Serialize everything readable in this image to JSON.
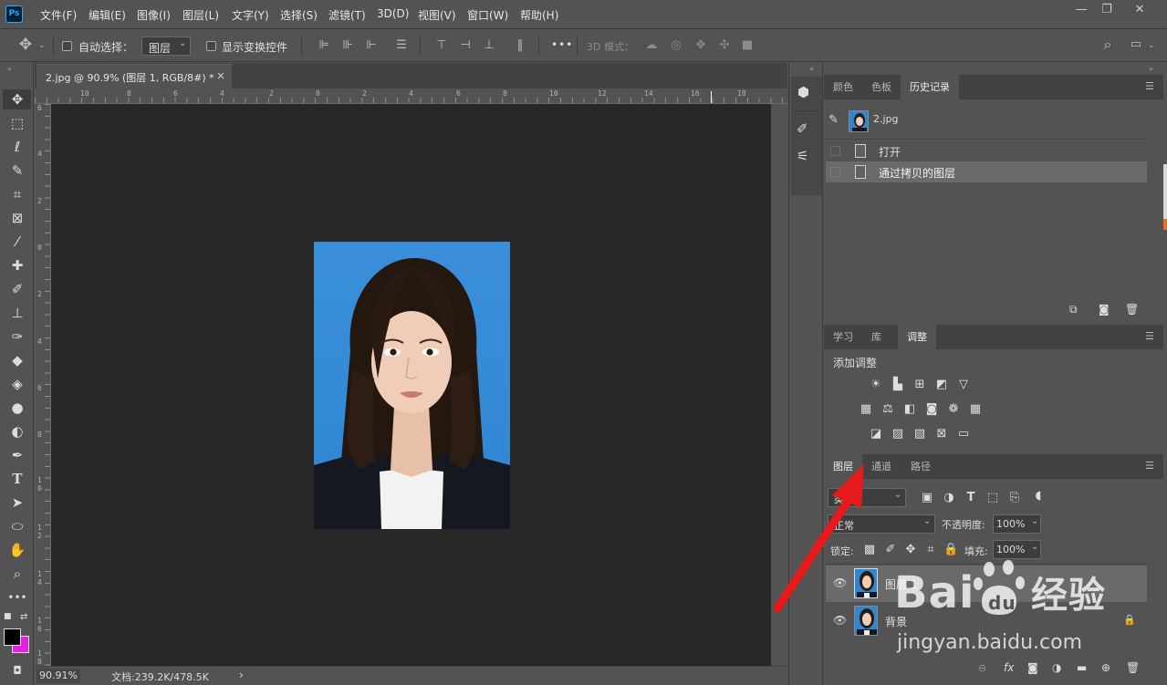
{
  "menubar": {
    "logo": "Ps",
    "items": [
      "文件(F)",
      "编辑(E)",
      "图像(I)",
      "图层(L)",
      "文字(Y)",
      "选择(S)",
      "滤镜(T)",
      "3D(D)",
      "视图(V)",
      "窗口(W)",
      "帮助(H)"
    ],
    "window_controls": [
      "—",
      "❐",
      "✕"
    ]
  },
  "options": {
    "auto_select_label": "自动选择：",
    "auto_select_value": "图层",
    "show_transform_label": "显示变换控件",
    "more": "•••",
    "mode_3d_label": "3D 模式："
  },
  "document": {
    "tab_title": "2.jpg @ 90.9% (图层 1, RGB/8#) *",
    "tab_close": "×",
    "ruler_top": [
      "10",
      "8",
      "6",
      "4",
      "2",
      "0",
      "2",
      "4",
      "6",
      "8",
      "10",
      "12",
      "14",
      "16",
      "18"
    ],
    "ruler_left": [
      "6",
      "4",
      "2",
      "0",
      "2",
      "4",
      "6",
      "8",
      "1\n0",
      "1\n2",
      "1\n4",
      "1\n6",
      "1\n8"
    ],
    "zoom": "90.91%",
    "doc_info": "文档:239.2K/478.5K",
    "status_arrow": "›"
  },
  "history_panel": {
    "tabs": [
      "颜色",
      "色板",
      "历史记录"
    ],
    "active_tab": "历史记录",
    "snapshot": "2.jpg",
    "steps": [
      "打开",
      "通过拷贝的图层"
    ]
  },
  "adjust_panel": {
    "tabs": [
      "学习",
      "库",
      "调整"
    ],
    "active_tab": "调整",
    "title": "添加调整"
  },
  "layers_panel": {
    "tabs": [
      "图层",
      "通道",
      "路径"
    ],
    "active_tab": "图层",
    "filter_label": "类型",
    "blend_mode": "正常",
    "opacity_label": "不透明度:",
    "opacity_value": "100%",
    "lock_label": "锁定:",
    "fill_label": "填充:",
    "fill_value": "100%",
    "layers": [
      {
        "name": "图层 1",
        "selected": true
      },
      {
        "name": "背景",
        "locked": true
      }
    ]
  },
  "watermark": {
    "logo": "Bai du 经验",
    "url": "jingyan.baidu.com"
  },
  "colors": {
    "accent": "#31a8ff",
    "bg_panel": "#535353",
    "bg_canvas": "#282828",
    "photo_bg": "#2f86d3",
    "arrow_red": "#e8191b",
    "bg_color_swatch": "#e61ee6"
  }
}
